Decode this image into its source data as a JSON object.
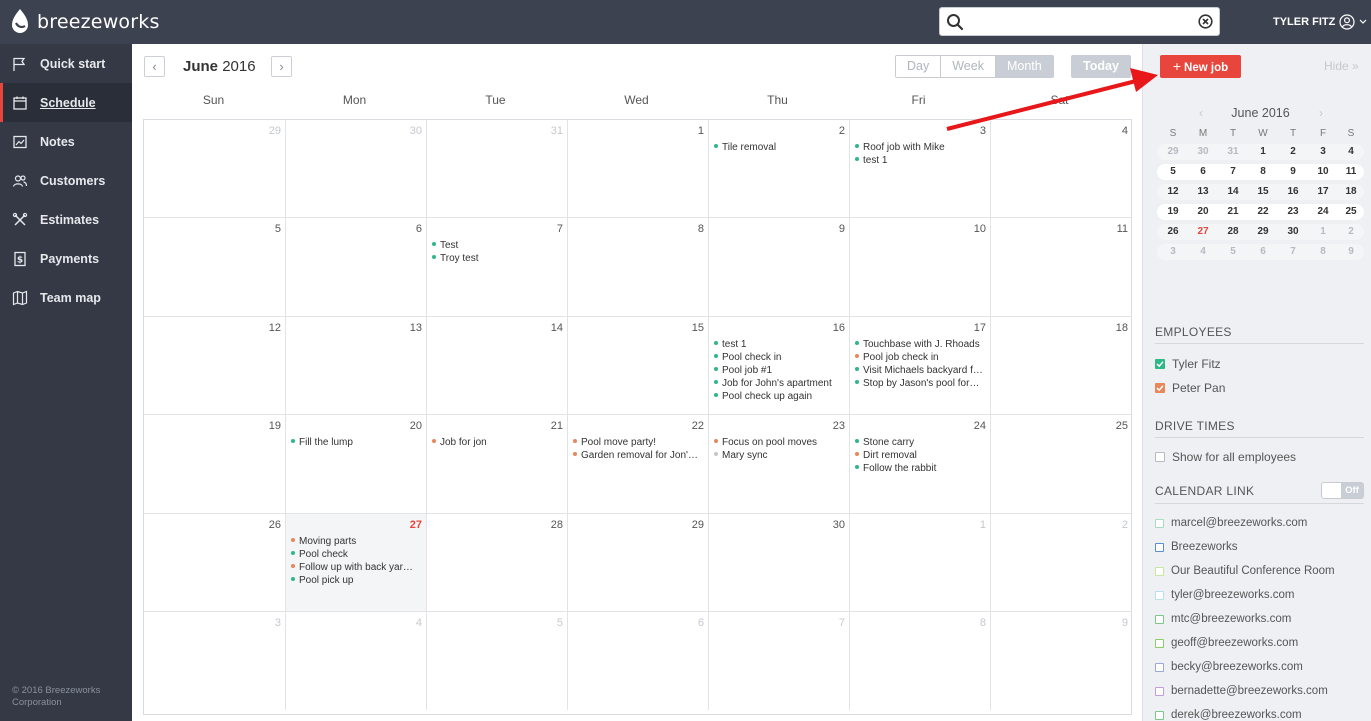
{
  "brand": {
    "name": "breezeworks"
  },
  "search": {
    "value": "",
    "placeholder": ""
  },
  "user": {
    "name": "TYLER FITZ"
  },
  "sidebar": {
    "items": [
      {
        "label": "Quick start",
        "icon": "flag-icon"
      },
      {
        "label": "Schedule",
        "icon": "calendar-icon",
        "active": true
      },
      {
        "label": "Notes",
        "icon": "notes-icon"
      },
      {
        "label": "Customers",
        "icon": "users-icon"
      },
      {
        "label": "Estimates",
        "icon": "tools-icon"
      },
      {
        "label": "Payments",
        "icon": "dollar-icon"
      },
      {
        "label": "Team map",
        "icon": "map-icon"
      }
    ],
    "copyright": "© 2016 Breezeworks Corporation"
  },
  "header": {
    "month": "June",
    "year": "2016",
    "views": [
      "Day",
      "Week",
      "Month"
    ],
    "selected_view": "Month",
    "today_label": "Today"
  },
  "weekdays": [
    "Sun",
    "Mon",
    "Tue",
    "Wed",
    "Thu",
    "Fri",
    "Sat"
  ],
  "colors": {
    "green": "#2fb886",
    "orange": "#e8875a",
    "gray": "#c4c8ce",
    "accent": "#e8453c"
  },
  "weeks": [
    [
      {
        "d": "29",
        "other": true,
        "events": []
      },
      {
        "d": "30",
        "other": true,
        "events": []
      },
      {
        "d": "31",
        "other": true,
        "events": []
      },
      {
        "d": "1",
        "events": []
      },
      {
        "d": "2",
        "events": [
          {
            "t": "Tile removal",
            "c": "green"
          }
        ]
      },
      {
        "d": "3",
        "events": [
          {
            "t": "Roof job with Mike",
            "c": "green"
          },
          {
            "t": "test 1",
            "c": "green"
          }
        ]
      },
      {
        "d": "4",
        "events": []
      }
    ],
    [
      {
        "d": "5",
        "events": []
      },
      {
        "d": "6",
        "events": []
      },
      {
        "d": "7",
        "events": [
          {
            "t": "Test",
            "c": "green"
          },
          {
            "t": "Troy test",
            "c": "green"
          }
        ]
      },
      {
        "d": "8",
        "events": []
      },
      {
        "d": "9",
        "events": []
      },
      {
        "d": "10",
        "events": []
      },
      {
        "d": "11",
        "events": []
      }
    ],
    [
      {
        "d": "12",
        "events": []
      },
      {
        "d": "13",
        "events": []
      },
      {
        "d": "14",
        "events": []
      },
      {
        "d": "15",
        "events": []
      },
      {
        "d": "16",
        "events": [
          {
            "t": "test 1",
            "c": "green"
          },
          {
            "t": "Pool check in",
            "c": "green"
          },
          {
            "t": "Pool job #1",
            "c": "green"
          },
          {
            "t": "Job for John's apartment",
            "c": "green"
          },
          {
            "t": "Pool check up again",
            "c": "green"
          }
        ]
      },
      {
        "d": "17",
        "events": [
          {
            "t": "Touchbase with J. Rhoads",
            "c": "green"
          },
          {
            "t": "Pool job check in",
            "c": "orange"
          },
          {
            "t": "Visit Michaels backyard f…",
            "c": "green"
          },
          {
            "t": "Stop by Jason's pool for…",
            "c": "green"
          }
        ]
      },
      {
        "d": "18",
        "events": []
      }
    ],
    [
      {
        "d": "19",
        "events": []
      },
      {
        "d": "20",
        "events": [
          {
            "t": "Fill the lump",
            "c": "green"
          }
        ]
      },
      {
        "d": "21",
        "events": [
          {
            "t": "Job for jon",
            "c": "orange"
          }
        ]
      },
      {
        "d": "22",
        "events": [
          {
            "t": "Pool move party!",
            "c": "orange"
          },
          {
            "t": "Garden removal for Jon'…",
            "c": "orange"
          }
        ]
      },
      {
        "d": "23",
        "events": [
          {
            "t": "Focus on pool moves",
            "c": "orange"
          },
          {
            "t": "Mary sync",
            "c": "gray"
          }
        ]
      },
      {
        "d": "24",
        "events": [
          {
            "t": "Stone carry",
            "c": "green"
          },
          {
            "t": "Dirt removal",
            "c": "orange"
          },
          {
            "t": "Follow the rabbit",
            "c": "green"
          }
        ]
      },
      {
        "d": "25",
        "events": []
      }
    ],
    [
      {
        "d": "26",
        "events": []
      },
      {
        "d": "27",
        "today": true,
        "events": [
          {
            "t": "Moving parts",
            "c": "orange"
          },
          {
            "t": "Pool check",
            "c": "green"
          },
          {
            "t": "Follow up with back yar…",
            "c": "orange"
          },
          {
            "t": "Pool pick up",
            "c": "green"
          }
        ]
      },
      {
        "d": "28",
        "events": []
      },
      {
        "d": "29",
        "events": []
      },
      {
        "d": "30",
        "events": []
      },
      {
        "d": "1",
        "other": true,
        "events": []
      },
      {
        "d": "2",
        "other": true,
        "events": []
      }
    ],
    [
      {
        "d": "3",
        "other": true,
        "events": []
      },
      {
        "d": "4",
        "other": true,
        "events": []
      },
      {
        "d": "5",
        "other": true,
        "events": []
      },
      {
        "d": "6",
        "other": true,
        "events": []
      },
      {
        "d": "7",
        "other": true,
        "events": []
      },
      {
        "d": "8",
        "other": true,
        "events": []
      },
      {
        "d": "9",
        "other": true,
        "events": []
      }
    ]
  ],
  "right_panel": {
    "new_job_label": "New job",
    "hide_label": "Hide »",
    "mini_cal": {
      "title": "June 2016",
      "dow": [
        "S",
        "M",
        "T",
        "W",
        "T",
        "F",
        "S"
      ],
      "weeks": [
        [
          "29",
          "30",
          "31",
          "1",
          "2",
          "3",
          "4"
        ],
        [
          "5",
          "6",
          "7",
          "8",
          "9",
          "10",
          "11"
        ],
        [
          "12",
          "13",
          "14",
          "15",
          "16",
          "17",
          "18"
        ],
        [
          "19",
          "20",
          "21",
          "22",
          "23",
          "24",
          "25"
        ],
        [
          "26",
          "27",
          "28",
          "29",
          "30",
          "1",
          "2"
        ],
        [
          "3",
          "4",
          "5",
          "6",
          "7",
          "8",
          "9"
        ]
      ]
    },
    "employees_title": "EMPLOYEES",
    "employees": [
      {
        "name": "Tyler Fitz",
        "color": "#2fb886"
      },
      {
        "name": "Peter Pan",
        "color": "#e8875a"
      }
    ],
    "drive_times_title": "DRIVE TIMES",
    "drive_times_option": "Show for all employees",
    "calendar_link_title": "CALENDAR LINK",
    "calendar_link_toggle": "Off",
    "calendars": [
      {
        "name": "marcel@breezeworks.com",
        "color": "#a8dcc0"
      },
      {
        "name": "Breezeworks",
        "color": "#5a8fd0"
      },
      {
        "name": "Our Beautiful Conference Room",
        "color": "#c8e6a0"
      },
      {
        "name": "tyler@breezeworks.com",
        "color": "#b8e0ec"
      },
      {
        "name": "mtc@breezeworks.com",
        "color": "#7cc88a"
      },
      {
        "name": "geoff@breezeworks.com",
        "color": "#8acc6a"
      },
      {
        "name": "becky@breezeworks.com",
        "color": "#9aa8e0"
      },
      {
        "name": "bernadette@breezeworks.com",
        "color": "#c49ae0"
      },
      {
        "name": "derek@breezeworks.com",
        "color": "#7cc88a"
      }
    ]
  }
}
